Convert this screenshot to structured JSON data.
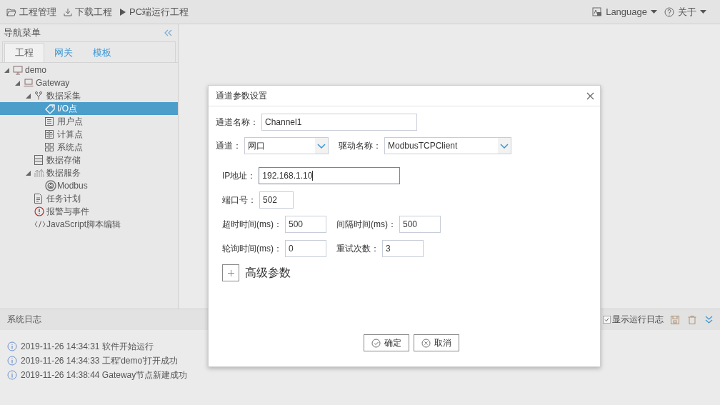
{
  "toolbar": {
    "items": [
      {
        "label": "工程管理",
        "kind": "folder"
      },
      {
        "label": "下载工程",
        "kind": "download"
      },
      {
        "label": "PC端运行工程",
        "kind": "run"
      }
    ],
    "menus": [
      {
        "label": "Language",
        "kind": "language"
      },
      {
        "label": "关于",
        "kind": "help"
      }
    ]
  },
  "nav": {
    "title": "导航菜单",
    "tabs": [
      {
        "label": "工程",
        "selected": true
      },
      {
        "label": "网关",
        "selected": false
      },
      {
        "label": "模板",
        "selected": false
      }
    ],
    "tree": [
      {
        "label": "demo",
        "kind": "monitor",
        "expanded": true,
        "selected": false,
        "children": [
          {
            "label": "Gateway",
            "kind": "laptop",
            "expanded": true,
            "selected": false,
            "children": [
              {
                "label": "数据采集",
                "kind": "branch",
                "expanded": true,
                "selected": false,
                "children": [
                  {
                    "label": "I/O点",
                    "kind": "tag",
                    "selected": true
                  },
                  {
                    "label": "用户点",
                    "kind": "list",
                    "selected": false
                  },
                  {
                    "label": "计算点",
                    "kind": "calc",
                    "selected": false
                  },
                  {
                    "label": "系统点",
                    "kind": "grid",
                    "selected": false
                  }
                ]
              },
              {
                "label": "数据存储",
                "kind": "storage",
                "selected": false
              },
              {
                "label": "数据服务",
                "kind": "chart",
                "expanded": true,
                "selected": false,
                "children": [
                  {
                    "label": "Modbus",
                    "kind": "badge",
                    "selected": false
                  }
                ]
              },
              {
                "label": "任务计划",
                "kind": "doc",
                "selected": false
              },
              {
                "label": "报警与事件",
                "kind": "alert",
                "selected": false
              },
              {
                "label": "JavaScript脚本编辑",
                "kind": "code",
                "selected": false
              }
            ]
          }
        ]
      }
    ]
  },
  "dialog": {
    "title": "通道参数设置",
    "rows": [
      {
        "fields": [
          {
            "label": "通道名称：",
            "value": "Channel1",
            "kind": "text"
          }
        ]
      },
      {
        "fields": [
          {
            "label": "通道：",
            "value": "网口",
            "kind": "select"
          },
          {
            "label": "驱动名称：",
            "value": "ModbusTCPClient",
            "kind": "select"
          }
        ]
      },
      {
        "fields": [
          {
            "label": "IP地址：",
            "value": "192.168.1.10",
            "kind": "text",
            "focused": true
          }
        ]
      },
      {
        "fields": [
          {
            "label": "端口号：",
            "value": "502",
            "kind": "text"
          }
        ]
      },
      {
        "fields": [
          {
            "label": "超时时间(ms)：",
            "value": "500",
            "kind": "text"
          },
          {
            "label": "间隔时间(ms)：",
            "value": "500",
            "kind": "text"
          }
        ]
      },
      {
        "fields": [
          {
            "label": "轮询时间(ms)：",
            "value": "0",
            "kind": "text"
          },
          {
            "label": "重试次数：",
            "value": "3",
            "kind": "text"
          }
        ]
      }
    ],
    "advanced": {
      "label": "高级参数",
      "expanded": false
    },
    "buttons": [
      {
        "label": "确定",
        "kind": "ok"
      },
      {
        "label": "取消",
        "kind": "cancel"
      }
    ]
  },
  "log": {
    "title": "系统日志",
    "show_run_log": {
      "label": "显示运行日志",
      "checked": true
    },
    "entries": [
      {
        "kind": "info",
        "text": "2019-11-26 14:34:31 软件开始运行"
      },
      {
        "kind": "info",
        "text": "2019-11-26 14:34:33 工程'demo'打开成功"
      },
      {
        "kind": "info",
        "text": "2019-11-26 14:38:44 Gateway节点新建成功"
      }
    ]
  }
}
